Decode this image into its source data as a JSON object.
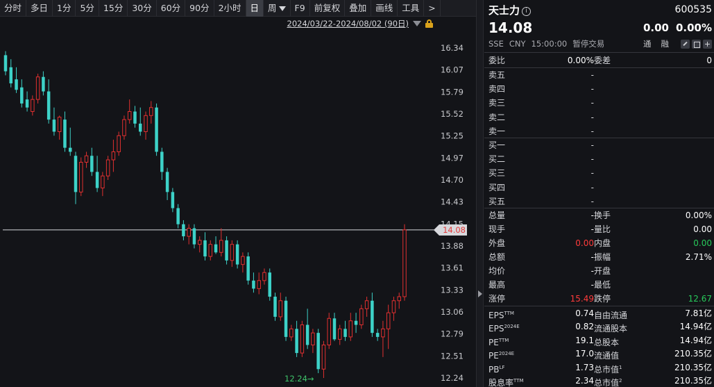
{
  "toolbar": {
    "items": [
      "分时",
      "多日",
      "1分",
      "5分",
      "15分",
      "30分",
      "60分",
      "90分",
      "2小时",
      "日",
      "周",
      "F9",
      "前复权",
      "叠加",
      "画线",
      "工具",
      ">"
    ],
    "active": "日"
  },
  "chart": {
    "range_label": "2024/03/22-2024/08/02 (90日)",
    "price_tag": "14.08",
    "low_label": "12.24→",
    "y_ticks": [
      "16.34",
      "16.07",
      "15.79",
      "15.52",
      "15.25",
      "14.97",
      "14.70",
      "14.43",
      "14.15",
      "13.88",
      "13.61",
      "13.33",
      "13.06",
      "12.79",
      "12.51",
      "12.24"
    ],
    "colors": {
      "up": "#e23030",
      "down": "#3dd2c8",
      "background": "#131418",
      "last_price_line": "#d7d8dc"
    }
  },
  "chart_data": {
    "type": "candlestick",
    "ylim": [
      12.24,
      16.34
    ],
    "ohlc": [
      [
        16.25,
        16.3,
        16.0,
        16.05
      ],
      [
        16.1,
        16.2,
        15.85,
        15.9
      ],
      [
        15.95,
        16.1,
        15.78,
        15.82
      ],
      [
        15.85,
        15.95,
        15.6,
        15.65
      ],
      [
        15.7,
        15.8,
        15.55,
        15.6
      ],
      [
        15.55,
        15.75,
        15.5,
        15.7
      ],
      [
        15.7,
        16.02,
        15.65,
        15.98
      ],
      [
        15.98,
        16.05,
        15.75,
        15.8
      ],
      [
        15.8,
        15.95,
        15.4,
        15.45
      ],
      [
        15.45,
        15.6,
        15.25,
        15.3
      ],
      [
        15.3,
        15.5,
        15.2,
        15.48
      ],
      [
        15.45,
        15.55,
        15.05,
        15.1
      ],
      [
        15.1,
        15.35,
        15.0,
        15.05
      ],
      [
        15.0,
        15.05,
        14.4,
        14.55
      ],
      [
        14.55,
        14.98,
        14.5,
        14.92
      ],
      [
        14.92,
        15.05,
        14.85,
        15.0
      ],
      [
        15.0,
        15.1,
        14.75,
        14.8
      ],
      [
        14.8,
        15.0,
        14.55,
        14.6
      ],
      [
        14.6,
        14.8,
        14.5,
        14.75
      ],
      [
        14.75,
        15.0,
        14.7,
        14.95
      ],
      [
        14.95,
        15.2,
        14.8,
        15.05
      ],
      [
        15.05,
        15.3,
        15.0,
        15.25
      ],
      [
        15.25,
        15.5,
        15.2,
        15.45
      ],
      [
        15.45,
        15.7,
        15.4,
        15.55
      ],
      [
        15.55,
        15.62,
        15.35,
        15.4
      ],
      [
        15.4,
        15.6,
        15.25,
        15.3
      ],
      [
        15.3,
        15.55,
        15.2,
        15.5
      ],
      [
        15.5,
        15.68,
        15.4,
        15.6
      ],
      [
        15.6,
        15.65,
        15.0,
        15.05
      ],
      [
        15.05,
        15.1,
        14.7,
        14.8
      ],
      [
        14.8,
        14.85,
        14.45,
        14.55
      ],
      [
        14.55,
        14.6,
        14.3,
        14.35
      ],
      [
        14.35,
        14.4,
        14.1,
        14.15
      ],
      [
        14.15,
        14.2,
        13.95,
        14.0
      ],
      [
        14.0,
        14.15,
        13.9,
        14.1
      ],
      [
        14.1,
        14.15,
        13.85,
        13.9
      ],
      [
        13.9,
        14.0,
        13.8,
        13.95
      ],
      [
        13.95,
        14.05,
        13.7,
        13.75
      ],
      [
        13.75,
        13.95,
        13.7,
        13.9
      ],
      [
        13.9,
        14.0,
        13.78,
        13.8
      ],
      [
        13.8,
        14.1,
        13.75,
        13.95
      ],
      [
        13.95,
        14.0,
        13.65,
        13.7
      ],
      [
        13.7,
        13.95,
        13.62,
        13.9
      ],
      [
        13.9,
        13.95,
        13.6,
        13.65
      ],
      [
        13.65,
        13.8,
        13.55,
        13.75
      ],
      [
        13.75,
        13.8,
        13.4,
        13.45
      ],
      [
        13.45,
        13.55,
        13.3,
        13.35
      ],
      [
        13.35,
        13.55,
        13.28,
        13.45
      ],
      [
        13.45,
        13.6,
        13.4,
        13.55
      ],
      [
        13.55,
        13.6,
        13.2,
        13.25
      ],
      [
        13.25,
        13.3,
        12.95,
        13.0
      ],
      [
        13.0,
        13.3,
        12.95,
        13.2
      ],
      [
        13.2,
        13.25,
        12.7,
        12.75
      ],
      [
        12.75,
        12.9,
        12.7,
        12.85
      ],
      [
        12.85,
        12.95,
        12.5,
        12.55
      ],
      [
        12.55,
        12.95,
        12.5,
        12.9
      ],
      [
        12.9,
        13.1,
        12.6,
        12.65
      ],
      [
        12.65,
        12.85,
        12.55,
        12.8
      ],
      [
        12.8,
        12.85,
        12.3,
        12.35
      ],
      [
        12.35,
        12.7,
        12.24,
        12.65
      ],
      [
        12.65,
        13.05,
        12.6,
        12.98
      ],
      [
        12.98,
        13.05,
        12.7,
        12.72
      ],
      [
        12.72,
        12.9,
        12.65,
        12.85
      ],
      [
        12.85,
        12.95,
        12.7,
        12.75
      ],
      [
        12.75,
        13.05,
        12.7,
        12.95
      ],
      [
        12.95,
        13.05,
        12.8,
        12.9
      ],
      [
        12.9,
        13.15,
        12.85,
        13.1
      ],
      [
        13.1,
        13.25,
        13.0,
        13.2
      ],
      [
        13.2,
        13.3,
        12.75,
        12.8
      ],
      [
        12.8,
        12.85,
        12.7,
        12.75
      ],
      [
        12.75,
        12.95,
        12.5,
        12.85
      ],
      [
        12.85,
        13.15,
        12.6,
        13.05
      ],
      [
        13.05,
        13.25,
        12.95,
        13.2
      ],
      [
        13.2,
        13.3,
        13.1,
        13.25
      ],
      [
        13.25,
        14.15,
        13.2,
        14.08
      ]
    ]
  },
  "panel": {
    "name": "天士力",
    "info_icon": "i",
    "code": "600535",
    "price": "14.08",
    "change": "0.00",
    "change_pct": "0.00%",
    "meta": [
      "SSE",
      "CNY",
      "15:00:00",
      "暂停交易"
    ],
    "meta_right": [
      "通",
      "融"
    ],
    "weibi": {
      "label": "委比",
      "value": "0.00%",
      "label2": "委差",
      "value2": "0"
    },
    "sell": [
      {
        "label": "卖五",
        "value": "-"
      },
      {
        "label": "卖四",
        "value": "-"
      },
      {
        "label": "卖三",
        "value": "-"
      },
      {
        "label": "卖二",
        "value": "-"
      },
      {
        "label": "卖一",
        "value": "-"
      }
    ],
    "buy": [
      {
        "label": "买一",
        "value": "-"
      },
      {
        "label": "买二",
        "value": "-"
      },
      {
        "label": "买三",
        "value": "-"
      },
      {
        "label": "买四",
        "value": "-"
      },
      {
        "label": "买五",
        "value": "-"
      }
    ],
    "stats": [
      {
        "l1": "总量",
        "v1": "-",
        "l2": "换手",
        "v2": "0.00%"
      },
      {
        "l1": "现手",
        "v1": "-",
        "l2": "量比",
        "v2": "0.00"
      },
      {
        "l1": "外盘",
        "v1": "0.00",
        "l2": "内盘",
        "v2": "0.00"
      },
      {
        "l1": "总额",
        "v1": "-",
        "l2": "振幅",
        "v2": "2.71%"
      },
      {
        "l1": "均价",
        "v1": "-",
        "l2": "开盘",
        "v2": ""
      },
      {
        "l1": "最高",
        "v1": "-",
        "l2": "最低",
        "v2": ""
      },
      {
        "l1": "涨停",
        "v1": "15.49",
        "l2": "跌停",
        "v2": "12.67"
      }
    ],
    "fundamentals": [
      {
        "l1": "EPS",
        "s1": "TTM",
        "v1": "0.74",
        "l2": "自由流通",
        "s2": "",
        "v2": "7.81亿"
      },
      {
        "l1": "EPS",
        "s1": "2024E",
        "v1": "0.82",
        "l2": "流通股本",
        "s2": "",
        "v2": "14.94亿"
      },
      {
        "l1": "PE",
        "s1": "TTM",
        "v1": "19.1",
        "l2": "总股本",
        "s2": "",
        "v2": "14.94亿"
      },
      {
        "l1": "PE",
        "s1": "2024E",
        "v1": "17.0",
        "l2": "流通值",
        "s2": "",
        "v2": "210.35亿"
      },
      {
        "l1": "PB",
        "s1": "LF",
        "v1": "1.73",
        "l2": "总市值",
        "s2": "1",
        "v2": "210.35亿"
      },
      {
        "l1": "股息率",
        "s1": "TTM",
        "v1": "2.34",
        "l2": "总市值",
        "s2": "2",
        "v2": "210.35亿"
      }
    ]
  }
}
